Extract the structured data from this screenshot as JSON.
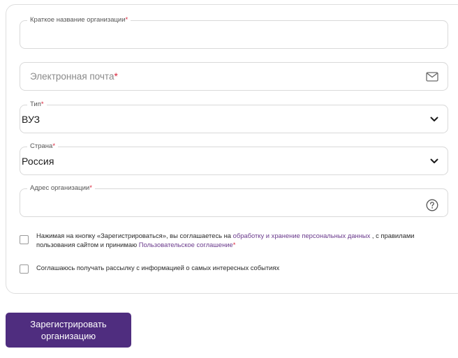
{
  "form": {
    "short_name": {
      "label": "Краткое название организации",
      "required_mark": "*",
      "value": ""
    },
    "email": {
      "placeholder": "Электронная почта",
      "required_mark": "*",
      "icon": "envelope-icon"
    },
    "type": {
      "label": "Тип",
      "required_mark": "*",
      "value": "ВУЗ",
      "icon": "chevron-down-icon"
    },
    "country": {
      "label": "Страна",
      "required_mark": "*",
      "value": "Россия",
      "icon": "chevron-down-icon"
    },
    "address": {
      "label": "Адрес организации",
      "required_mark": "*",
      "value": "",
      "icon": "question-circle-icon"
    },
    "consent": {
      "text_a": "Нажимая на кнопку «Зарегистрироваться», вы соглашаетесь на ",
      "link_a": "обработку и хранение персональных данных",
      "text_b": " , с правилами пользования сайтом и принимаю ",
      "link_b": "Пользовательское соглашение",
      "required_mark": "*",
      "checked": false
    },
    "newsletter": {
      "text": "Соглашаюсь получать рассылку с информацией о самых интересных событиях",
      "checked": false
    },
    "submit_label": "Зарегистрировать организацию"
  },
  "colors": {
    "accent": "#4f2d7f",
    "required": "#d9233a",
    "link": "#6a3a8c",
    "border": "#d9d9d9"
  }
}
